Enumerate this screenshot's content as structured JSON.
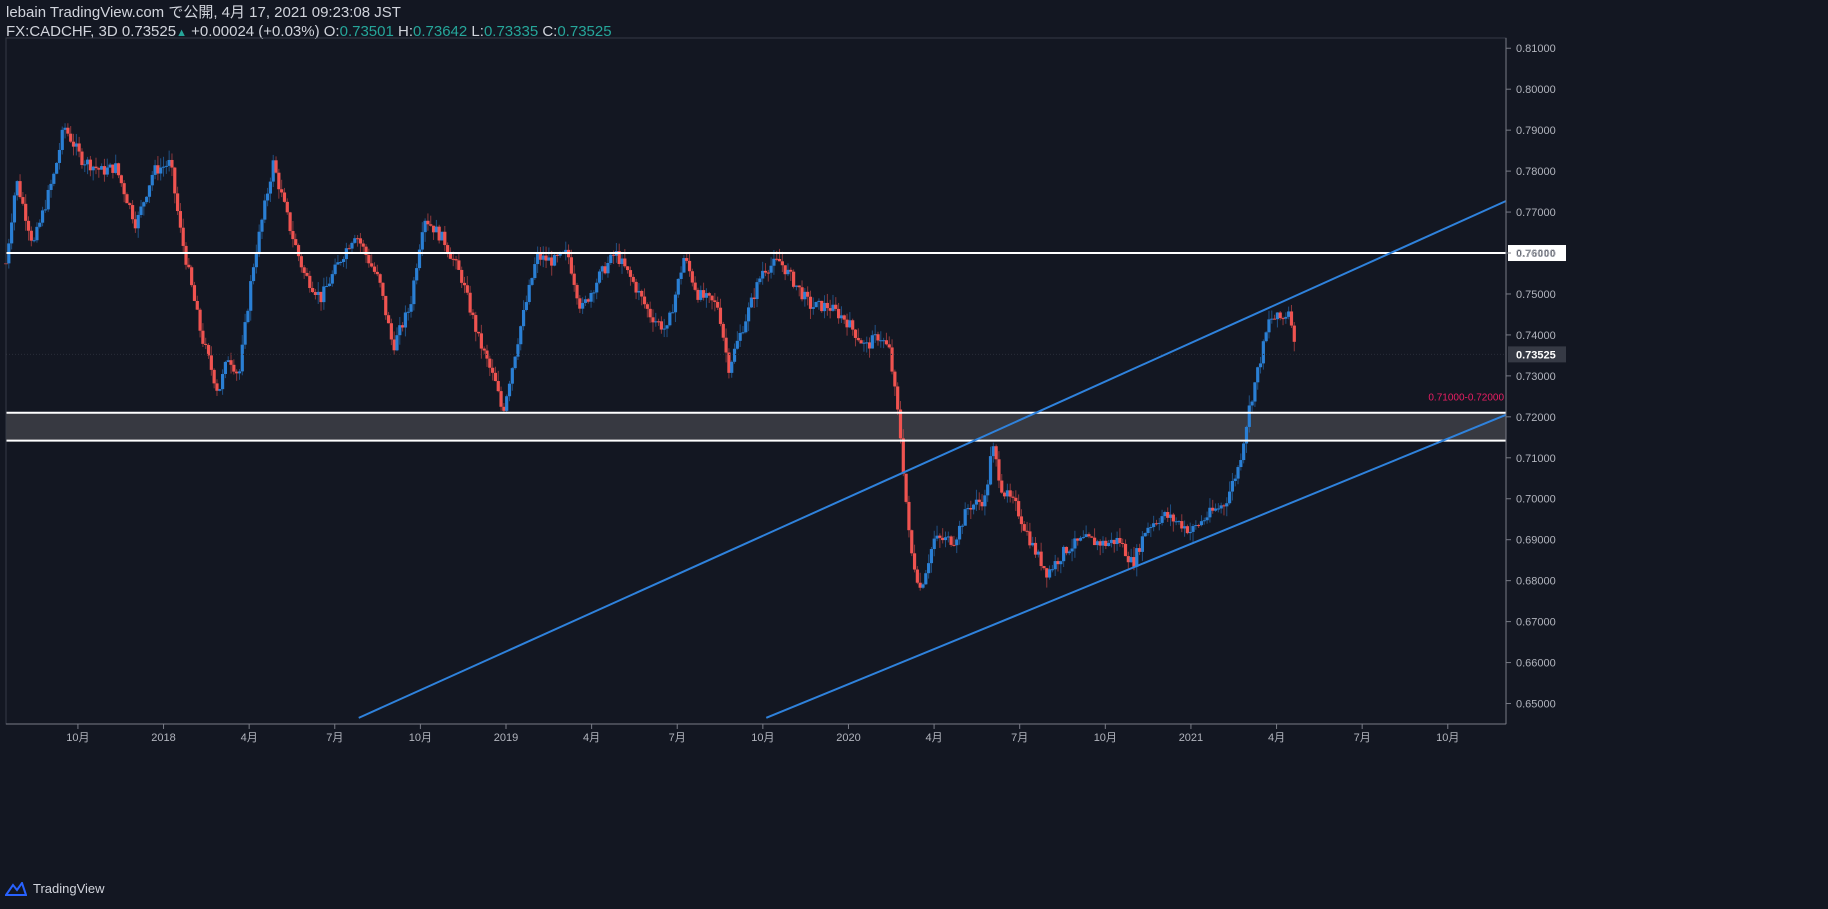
{
  "header": {
    "line1": "lebain TradingView.com で公開, 4月 17, 2021 09:23:08 JST",
    "symbol": "FX:CADCHF, 3D",
    "last": "0.73525",
    "change_arrow": "▲",
    "change": "+0.00024 (+0.03%)",
    "o_label": "O:",
    "o_value": "0.73501",
    "h_label": "H:",
    "h_value": "0.73642",
    "l_label": "L:",
    "l_value": "0.73335",
    "c_label": "C:",
    "c_value": "0.73525"
  },
  "footer": {
    "brand": "TradingView"
  },
  "colors": {
    "background": "#131722",
    "up": "#2a7fd4",
    "down": "#ef5350",
    "trendline": "#2f82dc",
    "level": "#ffffff",
    "zone": "#3c3d45",
    "zone_label": "#e91e63",
    "grid": "#1e222d",
    "axis_text": "#b2b5be"
  },
  "chart_data": {
    "type": "candlestick",
    "symbol": "FX:CADCHF",
    "timeframe": "3D",
    "ylim": [
      0.645,
      0.8125
    ],
    "y_ticks": [
      "0.81000",
      "0.80000",
      "0.79000",
      "0.78000",
      "0.77000",
      "0.76000",
      "0.75000",
      "0.74000",
      "0.73000",
      "0.72000",
      "0.71000",
      "0.70000",
      "0.69000",
      "0.68000",
      "0.67000",
      "0.66000",
      "0.65000"
    ],
    "x_ticks": [
      {
        "label": "10月",
        "t": 2017.75
      },
      {
        "label": "2018",
        "t": 2018.0
      },
      {
        "label": "4月",
        "t": 2018.25
      },
      {
        "label": "7月",
        "t": 2018.5
      },
      {
        "label": "10月",
        "t": 2018.75
      },
      {
        "label": "2019",
        "t": 2019.0
      },
      {
        "label": "4月",
        "t": 2019.25
      },
      {
        "label": "7月",
        "t": 2019.5
      },
      {
        "label": "10月",
        "t": 2019.75
      },
      {
        "label": "2020",
        "t": 2020.0
      },
      {
        "label": "4月",
        "t": 2020.25
      },
      {
        "label": "7月",
        "t": 2020.5
      },
      {
        "label": "10月",
        "t": 2020.75
      },
      {
        "label": "2021",
        "t": 2021.0
      },
      {
        "label": "4月",
        "t": 2021.25
      },
      {
        "label": "7月",
        "t": 2021.5
      },
      {
        "label": "10月",
        "t": 2021.75
      }
    ],
    "xlim": [
      2017.54,
      2021.92
    ],
    "price_tag": "0.73525",
    "last_price": 0.73525,
    "levels": [
      {
        "price": 0.76,
        "label": "0.76000"
      },
      {
        "price": 0.721
      },
      {
        "price": 0.7142
      }
    ],
    "zone": {
      "from": 0.7142,
      "to": 0.721,
      "label": "0.71000-0.72000"
    },
    "trendlines": [
      {
        "x1": 2018.57,
        "y1": 0.6465,
        "x2": 2021.92,
        "y2": 0.7727
      },
      {
        "x1": 2019.76,
        "y1": 0.6465,
        "x2": 2021.92,
        "y2": 0.7205
      }
    ],
    "anchors": [
      [
        2017.54,
        0.7575
      ],
      [
        2017.57,
        0.778
      ],
      [
        2017.62,
        0.762
      ],
      [
        2017.68,
        0.779
      ],
      [
        2017.71,
        0.791
      ],
      [
        2017.76,
        0.783
      ],
      [
        2017.82,
        0.78
      ],
      [
        2017.86,
        0.781
      ],
      [
        2017.92,
        0.767
      ],
      [
        2017.97,
        0.78
      ],
      [
        2018.02,
        0.782
      ],
      [
        2018.05,
        0.765
      ],
      [
        2018.11,
        0.74
      ],
      [
        2018.16,
        0.726
      ],
      [
        2018.19,
        0.735
      ],
      [
        2018.22,
        0.73
      ],
      [
        2018.26,
        0.756
      ],
      [
        2018.32,
        0.782
      ],
      [
        2018.37,
        0.766
      ],
      [
        2018.41,
        0.755
      ],
      [
        2018.46,
        0.749
      ],
      [
        2018.52,
        0.759
      ],
      [
        2018.56,
        0.765
      ],
      [
        2018.63,
        0.753
      ],
      [
        2018.67,
        0.737
      ],
      [
        2018.72,
        0.747
      ],
      [
        2018.76,
        0.769
      ],
      [
        2018.82,
        0.763
      ],
      [
        2018.87,
        0.754
      ],
      [
        2018.92,
        0.739
      ],
      [
        2018.97,
        0.728
      ],
      [
        2018.99,
        0.721
      ],
      [
        2019.04,
        0.741
      ],
      [
        2019.09,
        0.759
      ],
      [
        2019.14,
        0.758
      ],
      [
        2019.18,
        0.76
      ],
      [
        2019.22,
        0.746
      ],
      [
        2019.27,
        0.754
      ],
      [
        2019.32,
        0.76
      ],
      [
        2019.37,
        0.753
      ],
      [
        2019.42,
        0.745
      ],
      [
        2019.47,
        0.741
      ],
      [
        2019.52,
        0.759
      ],
      [
        2019.56,
        0.75
      ],
      [
        2019.62,
        0.747
      ],
      [
        2019.65,
        0.732
      ],
      [
        2019.7,
        0.744
      ],
      [
        2019.75,
        0.756
      ],
      [
        2019.8,
        0.758
      ],
      [
        2019.84,
        0.753
      ],
      [
        2019.89,
        0.747
      ],
      [
        2019.94,
        0.747
      ],
      [
        2019.99,
        0.744
      ],
      [
        2020.05,
        0.737
      ],
      [
        2020.09,
        0.74
      ],
      [
        2020.12,
        0.736
      ],
      [
        2020.15,
        0.717
      ],
      [
        2020.18,
        0.688
      ],
      [
        2020.21,
        0.678
      ],
      [
        2020.25,
        0.69
      ],
      [
        2020.31,
        0.69
      ],
      [
        2020.35,
        0.698
      ],
      [
        2020.4,
        0.7
      ],
      [
        2020.42,
        0.713
      ],
      [
        2020.45,
        0.702
      ],
      [
        2020.49,
        0.698
      ],
      [
        2020.54,
        0.688
      ],
      [
        2020.58,
        0.682
      ],
      [
        2020.64,
        0.688
      ],
      [
        2020.69,
        0.69
      ],
      [
        2020.75,
        0.689
      ],
      [
        2020.79,
        0.69
      ],
      [
        2020.83,
        0.684
      ],
      [
        2020.87,
        0.693
      ],
      [
        2020.92,
        0.696
      ],
      [
        2020.97,
        0.694
      ],
      [
        2021.0,
        0.692
      ],
      [
        2021.05,
        0.696
      ],
      [
        2021.1,
        0.699
      ],
      [
        2021.14,
        0.708
      ],
      [
        2021.17,
        0.722
      ],
      [
        2021.2,
        0.733
      ],
      [
        2021.23,
        0.744
      ],
      [
        2021.27,
        0.744
      ],
      [
        2021.29,
        0.747
      ],
      [
        2021.3,
        0.738
      ],
      [
        2021.31,
        0.735
      ]
    ]
  }
}
